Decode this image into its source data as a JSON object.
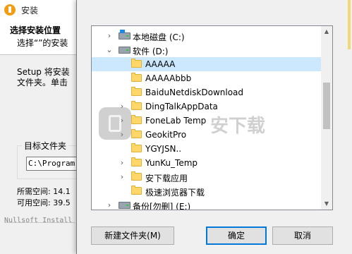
{
  "installer": {
    "title": "安装",
    "heading": "选择安装位置",
    "subheading": "选择“”的安装",
    "description": "Setup 将安装\n文件夹。单击",
    "destination_label": "目标文件夹",
    "destination_path": "C:\\Program",
    "space_required": "所需空间: 14.1",
    "space_available": "可用空间: 39.5",
    "branding": "Nullsoft Install"
  },
  "dialog": {
    "tree": [
      {
        "label": "本地磁盘 (C:)",
        "type": "drive-system",
        "expanded": false,
        "level": 0
      },
      {
        "label": "软件 (D:)",
        "type": "drive",
        "expanded": true,
        "level": 0
      },
      {
        "label": "AAAAA",
        "type": "folder",
        "expanded": false,
        "level": 1,
        "selected": true
      },
      {
        "label": "AAAAAbbb",
        "type": "folder",
        "expanded": false,
        "level": 1
      },
      {
        "label": "BaiduNetdiskDownload",
        "type": "folder",
        "expanded": false,
        "level": 1
      },
      {
        "label": "DingTalkAppData",
        "type": "folder",
        "expanded": false,
        "level": 1
      },
      {
        "label": "FoneLab Temp",
        "type": "folder",
        "expanded": false,
        "level": 1
      },
      {
        "label": "GeokitPro",
        "type": "folder",
        "expanded": false,
        "level": 1
      },
      {
        "label": "YGYJSN..",
        "type": "folder",
        "expanded": false,
        "level": 1
      },
      {
        "label": "YunKu_Temp",
        "type": "folder",
        "expanded": false,
        "level": 1
      },
      {
        "label": "安下载应用",
        "type": "folder",
        "expanded": false,
        "level": 1
      },
      {
        "label": "极速浏览器下载",
        "type": "folder",
        "expanded": false,
        "level": 1
      },
      {
        "label": "备份[勿删] (E:)",
        "type": "drive",
        "expanded": false,
        "level": 0
      }
    ],
    "buttons": {
      "new_folder": "新建文件夹(M)",
      "ok": "确定",
      "cancel": "取消"
    }
  },
  "watermark": "安下载"
}
